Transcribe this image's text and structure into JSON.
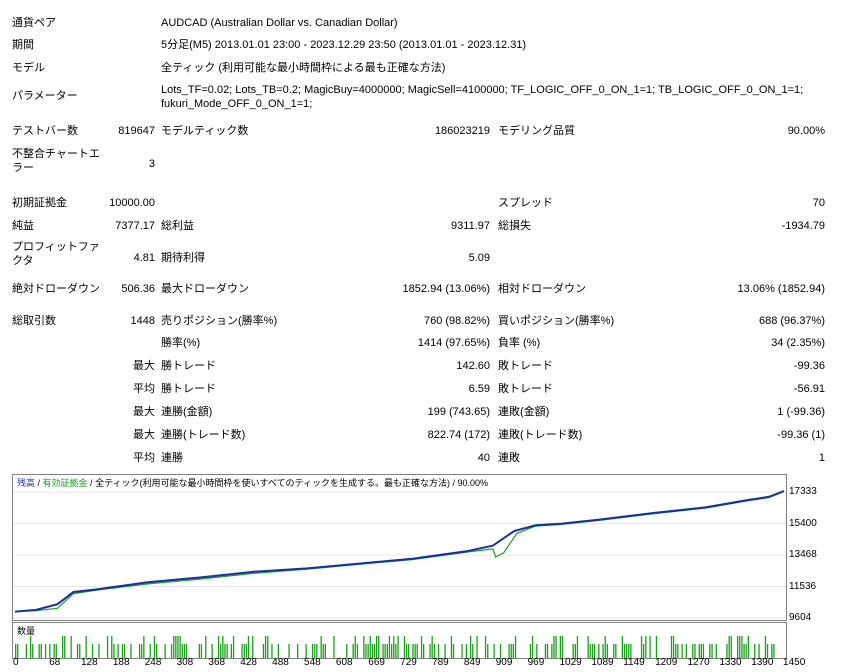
{
  "header": {
    "symbol_label": "通貨ペア",
    "symbol_value": "AUDCAD (Australian Dollar vs. Canadian Dollar)",
    "period_label": "期間",
    "period_value": "5分足(M5) 2013.01.01 23:00 - 2023.12.29 23:50 (2013.01.01 - 2023.12.31)",
    "model_label": "モデル",
    "model_value": "全ティック (利用可能な最小時間枠による最も正確な方法)",
    "params_label": "パラメーター",
    "params_value": "Lots_TF=0.02; Lots_TB=0.2; MagicBuy=4000000; MagicSell=4100000; TF_LOGIC_OFF_0_ON_1=1; TB_LOGIC_OFF_0_ON_1=1; fukuri_Mode_OFF_0_ON_1=1;"
  },
  "stats": {
    "bars_label": "テストバー数",
    "bars_value": "819647",
    "ticks_label": "モデルティック数",
    "ticks_value": "186023219",
    "quality_label": "モデリング品質",
    "quality_value": "90.00%",
    "mismatch_label": "不整合チャートエラー",
    "mismatch_value": "3",
    "deposit_label": "初期証拠金",
    "deposit_value": "10000.00",
    "spread_label": "スプレッド",
    "spread_value": "70",
    "net_label": "純益",
    "net_value": "7377.17",
    "gross_profit_label": "総利益",
    "gross_profit_value": "9311.97",
    "gross_loss_label": "総損失",
    "gross_loss_value": "-1934.79",
    "pf_label": "プロフィットファクタ",
    "pf_value": "4.81",
    "expected_label": "期待利得",
    "expected_value": "5.09",
    "abs_dd_label": "絶対ドローダウン",
    "abs_dd_value": "506.36",
    "max_dd_label": "最大ドローダウン",
    "max_dd_value": "1852.94 (13.06%)",
    "rel_dd_label": "相対ドローダウン",
    "rel_dd_value": "13.06% (1852.94)",
    "total_trades_label": "総取引数",
    "total_trades_value": "1448",
    "short_label": "売りポジション(勝率%)",
    "short_value": "760 (98.82%)",
    "long_label": "買いポジション(勝率%)",
    "long_value": "688 (96.37%)",
    "win_rate_label": "勝率(%)",
    "win_rate_value": "1414 (97.65%)",
    "loss_rate_label": "負率 (%)",
    "loss_rate_value": "34 (2.35%)",
    "max_label": "最大",
    "avg_label": "平均",
    "largest_win_label": "勝トレード",
    "largest_win_value": "142.60",
    "largest_loss_label": "敗トレード",
    "largest_loss_value": "-99.36",
    "avg_win_label": "勝トレード",
    "avg_win_value": "6.59",
    "avg_loss_label": "敗トレード",
    "avg_loss_value": "-56.91",
    "max_cons_win_money_label": "連勝(金額)",
    "max_cons_win_money_value": "199 (743.65)",
    "max_cons_loss_money_label": "連敗(金額)",
    "max_cons_loss_money_value": "1 (-99.36)",
    "max_cons_win_count_label": "連勝(トレード数)",
    "max_cons_win_count_value": "822.74 (172)",
    "max_cons_loss_count_label": "連敗(トレード数)",
    "max_cons_loss_count_value": "-99.36 (1)",
    "avg_cons_win_label": "連勝",
    "avg_cons_win_value": "40",
    "avg_cons_loss_label": "連敗",
    "avg_cons_loss_value": "1"
  },
  "chart_legend": {
    "balance": "残高",
    "sep1": " / ",
    "equity": "有効証拠金",
    "sep2": " / ",
    "model_text": "全ティック(利用可能な最小時間枠を使いすべてのティックを生成する。最も正確な方法)",
    "sep3": " / ",
    "quality": "90.00%"
  },
  "volume_label": "数量",
  "colors": {
    "balance": "#1c2f9e",
    "equity": "#19a019",
    "volume": "#19a019"
  },
  "chart_data": {
    "type": "line",
    "yticks": [
      17333,
      15400,
      13468,
      11536,
      9604
    ],
    "xticks": [
      0,
      68,
      128,
      188,
      248,
      308,
      368,
      428,
      488,
      548,
      608,
      669,
      729,
      789,
      849,
      909,
      969,
      1029,
      1089,
      1149,
      1209,
      1270,
      1330,
      1390,
      1450
    ],
    "ylim": [
      9604,
      17650
    ],
    "xlim": [
      0,
      1448
    ],
    "series": [
      {
        "name": "残高",
        "x": [
          0,
          40,
          80,
          110,
          150,
          250,
          350,
          450,
          550,
          650,
          750,
          850,
          900,
          940,
          980,
          1030,
          1100,
          1200,
          1300,
          1380,
          1420,
          1448
        ],
        "y": [
          10000,
          10100,
          10450,
          11200,
          11350,
          11800,
          12100,
          12450,
          12650,
          12950,
          13250,
          13700,
          14050,
          14950,
          15300,
          15400,
          15650,
          16050,
          16400,
          16850,
          17050,
          17400
        ]
      },
      {
        "name": "有効証拠金",
        "x": [
          0,
          40,
          80,
          110,
          150,
          250,
          350,
          450,
          550,
          650,
          750,
          850,
          900,
          905,
          920,
          945,
          980,
          1030,
          1100,
          1200,
          1300,
          1380,
          1420,
          1448
        ],
        "y": [
          10000,
          10050,
          10200,
          11100,
          11300,
          11700,
          12000,
          12350,
          12600,
          12900,
          13200,
          13650,
          13850,
          13350,
          13600,
          14800,
          15250,
          15350,
          15600,
          16000,
          16350,
          16800,
          17000,
          17380
        ]
      }
    ]
  }
}
